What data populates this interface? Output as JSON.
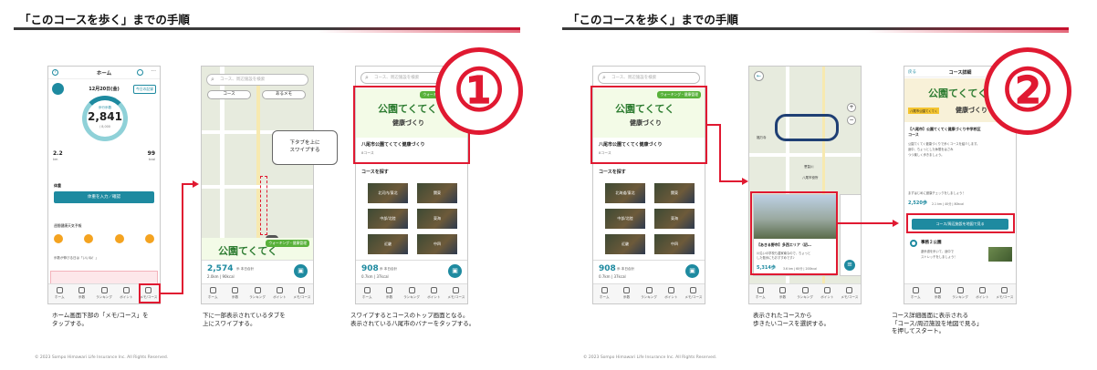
{
  "slides": [
    {
      "title": "「このコースを歩く」までの手順",
      "footer": "© 2023 Sompo Himawari Life Insurance Inc. All Rights Reserved.",
      "step_number": "①",
      "phones": [
        {
          "header": "ホーム",
          "date": "12月20日(金)",
          "today_button": "今日の記録",
          "steps_label": "歩行歩数",
          "steps_value": "2,841",
          "steps_unit": "歩",
          "steps_target": "/ 8,000",
          "distance_value": "2.2",
          "distance_unit": "km",
          "kcal_value": "99",
          "kcal_unit": "kcal",
          "weight_label": "体重",
          "weight_button": "体重を入力／確認",
          "weather_title": "週間健康天気予報",
          "temps": [
            "8°/1°",
            "10°/4°",
            "12°/5°",
            "11°/6°"
          ],
          "weather_note": "歩数が伸びる日は「いいね！」",
          "caption": [
            "ホーム画面下部の「メモ/コース」を",
            "タップする。"
          ]
        },
        {
          "search_placeholder": "コース、周辺施設を検索",
          "course_tab": "コース",
          "memo_tab": "あるメモ",
          "callout": [
            "下タブを上に",
            "スワイプする"
          ],
          "banner_title": "公園てくてく",
          "banner_sub": "健康づくり",
          "banner_pill": "ウォーキング・健康管理",
          "stat_value": "2,574",
          "stat_unit": "歩 本日合計",
          "stat_sub": "2.0km | 90kcal",
          "caption": [
            "下に一部表示されているタブを",
            "上にスワイプする。"
          ]
        },
        {
          "search_placeholder": "コース、周辺施設を検索",
          "banner_title": "公園てくてく",
          "banner_sub": "健康づくり",
          "banner_pill": "ウォーキング・健康管理",
          "banner_caption": "八尾市公園てくてく健康づくり",
          "banner_count": "8コース",
          "find_title": "コースを探す",
          "regions": [
            "北河内/東北",
            "関東",
            "中部/北陸",
            "東海",
            "近畿",
            "中四"
          ],
          "stat_value": "908",
          "stat_unit": "歩 本日合計",
          "stat_sub": "0.7km | 37kcal",
          "caption": [
            "スワイプするとコースのトップ画面となる。",
            "表示されている八尾市のバナーをタップする。"
          ]
        }
      ]
    },
    {
      "title": "「このコースを歩く」までの手順",
      "footer": "© 2023 Sompo Himawari Life Insurance Inc. All Rights Reserved.",
      "step_number": "②",
      "phones": [
        {
          "search_placeholder": "コース、周辺施設を検索",
          "banner_title": "公園てくてく",
          "banner_sub": "健康づくり",
          "banner_pill": "ウォーキング・健康管理",
          "banner_caption": "八尾市公園てくてく健康づくり",
          "banner_count": "8コース",
          "find_title": "コースを探す",
          "regions": [
            "北海道/東北",
            "関東",
            "中部/北陸",
            "東海",
            "近畿",
            "中四"
          ],
          "stat_value": "908",
          "stat_unit": "歩 本日合計",
          "stat_sub": "0.7km | 37kcal",
          "caption": []
        },
        {
          "map_labels": [
            "福万寺",
            "恩智川",
            "八尾市役所"
          ],
          "card_title": "【あきる野市】多西エリア（初…",
          "card_desc": [
            "川沿いの学校も農家南なので、ちょっと",
            "した散歩にもおすすめです♪"
          ],
          "card_stat": "5,314歩",
          "card_meta": "3.6 km | 60分 | 200kcal",
          "caption": [
            "表示されたコースから",
            "歩きたいコースを選択する。"
          ]
        },
        {
          "back_label": "戻る",
          "header": "コース詳細",
          "tag": "八尾市公園てくてく",
          "banner_title": "公園てくてく",
          "banner_sub": "健康づくり",
          "detail_title": [
            "【八尾市】公園てくてく健康づくり中学校区",
            "コース"
          ],
          "detail_desc": [
            "公園てくてく健康づくりで歩くコースを紹介します。",
            "途中、ちょっとした休憩をはさみ",
            "つつ楽しく歩きましょう。"
          ],
          "detail_note": "まずはじめに健康チェックをしましょう！",
          "detail_stat": "2,520歩",
          "detail_meta": "2.1 km | 40分 | 80kcal",
          "map_button": "コース/周辺施設を地図で見る",
          "spot_label": "事務２公園",
          "spot_desc": [
            "遊歩道を歩いて、途中で",
            "ストレッチをしましょう！"
          ],
          "caption": [
            "コース詳細画面に表示される",
            "「コース/周辺施設を地図で見る」",
            "を押してスタート。"
          ]
        }
      ]
    }
  ],
  "tabbar": [
    "ホーム",
    "歩数",
    "ランキング",
    "ポイント",
    "メモ/コース"
  ]
}
